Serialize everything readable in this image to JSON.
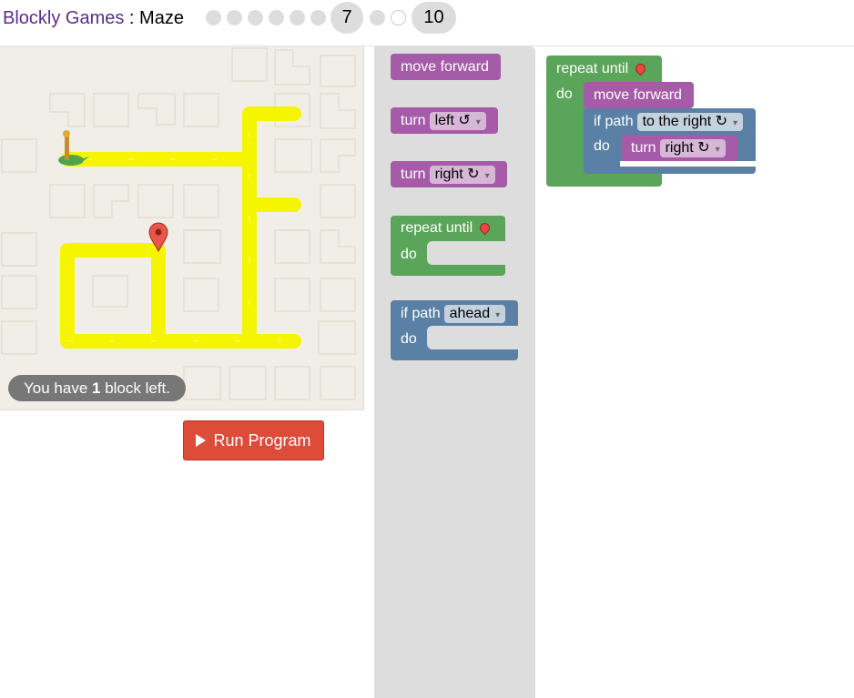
{
  "header": {
    "app_name": "Blockly Games",
    "separator": " : ",
    "game_name": "Maze",
    "levels": [
      "1",
      "2",
      "3",
      "4",
      "5",
      "6",
      "7",
      "8",
      "9",
      "10"
    ],
    "current_level": "7",
    "last_level": "10"
  },
  "maze": {
    "capacity_prefix": "You have ",
    "capacity_count": "1",
    "capacity_suffix": " block left."
  },
  "run_button": {
    "label": "Run Program"
  },
  "toolbox": {
    "move_forward": "move forward",
    "turn_left_label": "turn",
    "turn_left_value": "left ↺",
    "turn_right_label": "turn",
    "turn_right_value": "right ↻",
    "repeat_label": "repeat until",
    "repeat_do": "do",
    "if_label": "if path",
    "if_value": "ahead",
    "if_do": "do"
  },
  "workspace": {
    "repeat_label": "repeat until",
    "repeat_do": "do",
    "move_forward": "move forward",
    "if_label": "if path",
    "if_value": "to the right ↻",
    "if_do": "do",
    "turn_label": "turn",
    "turn_value": "right ↻"
  },
  "colors": {
    "motion": "#a55ba8",
    "loop": "#5ba55b",
    "logic": "#5b80a5",
    "run_button": "#dd4b39",
    "path": "#ffff00"
  }
}
